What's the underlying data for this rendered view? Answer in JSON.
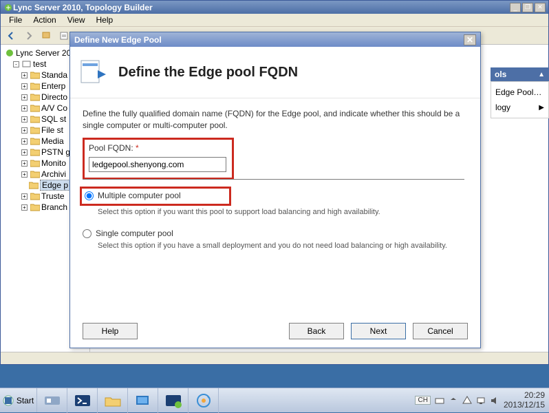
{
  "app": {
    "title": "Lync Server 2010, Topology Builder"
  },
  "menubar": {
    "file": "File",
    "action": "Action",
    "view": "View",
    "help": "Help"
  },
  "tree": {
    "root": "Lync Server 20",
    "site": "test",
    "items": [
      "Standa",
      "Enterp",
      "Directo",
      "A/V Co",
      "SQL st",
      "File st",
      "Media",
      "PSTN g",
      "Monito",
      "Archivi",
      "Edge p",
      "Truste",
      "Branch"
    ]
  },
  "panel": {
    "header": "ols",
    "link1": "Edge Pool…",
    "link2": "logy"
  },
  "dialog": {
    "title": "Define New Edge Pool",
    "heading": "Define the Edge pool FQDN",
    "intro": "Define the fully qualified domain name (FQDN) for the Edge pool, and indicate whether this should be a single computer or multi-computer pool.",
    "fqdn_label": "Pool FQDN:",
    "fqdn_value": "ledgepool.shenyong.com",
    "opt_multi": "Multiple computer pool",
    "opt_multi_desc": "Select this option if you want this pool to support load balancing and high availability.",
    "opt_single": "Single computer pool",
    "opt_single_desc": "Select this option if you have a small deployment and you do not need load balancing or high availability.",
    "help": "Help",
    "back": "Back",
    "next": "Next",
    "cancel": "Cancel"
  },
  "taskbar": {
    "start": "Start",
    "ime": "CH",
    "time": "20:29",
    "date": "2013/12/15"
  }
}
